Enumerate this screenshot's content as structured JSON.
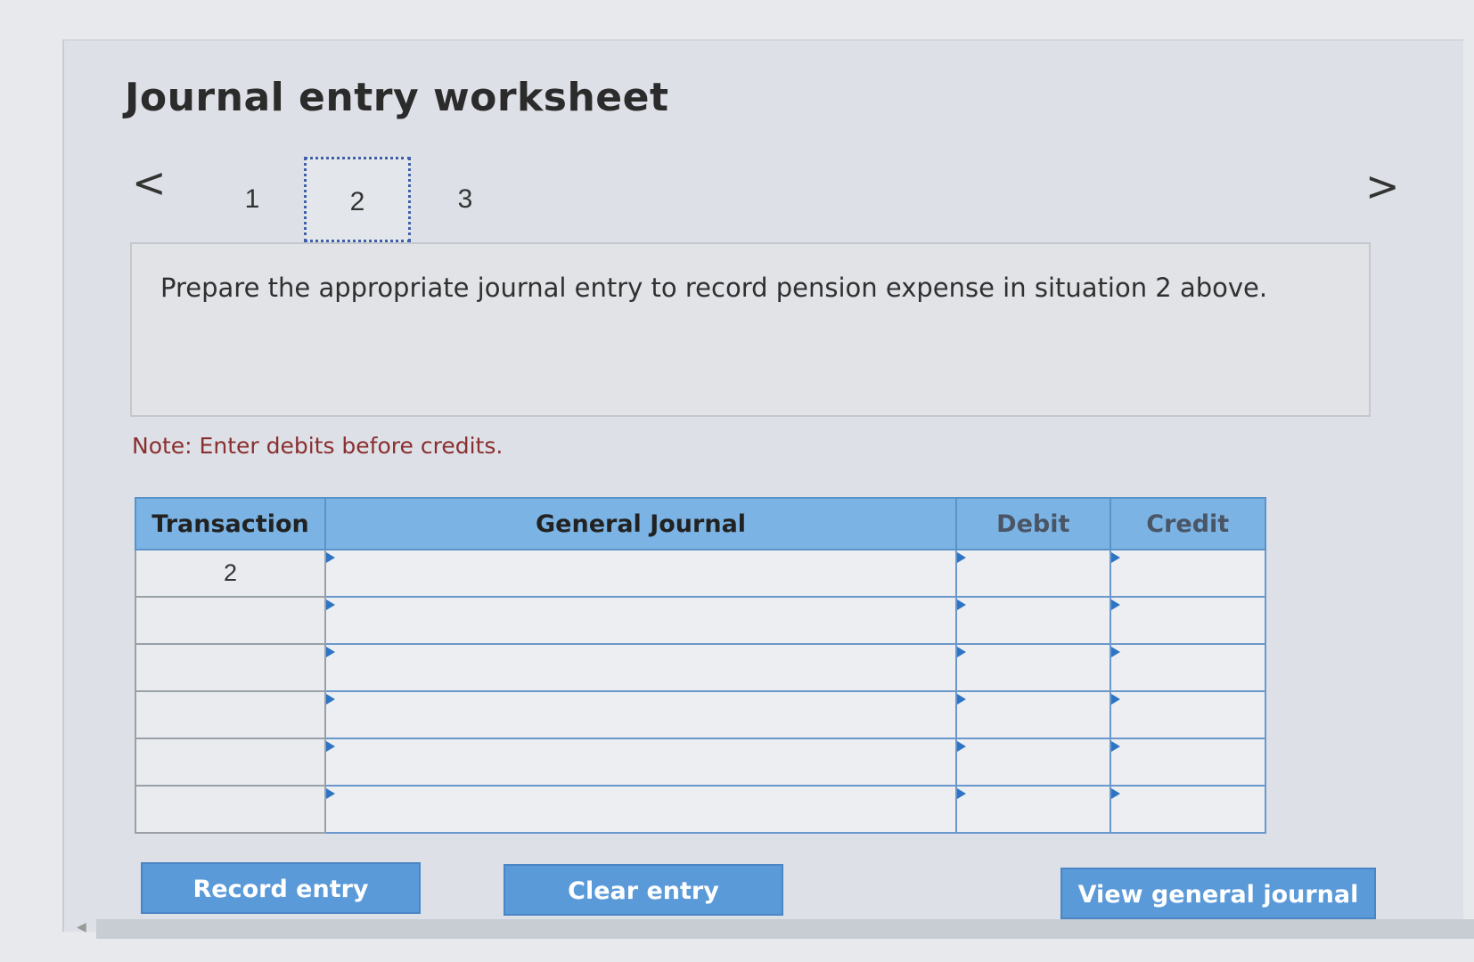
{
  "title": "Journal entry worksheet",
  "nav": {
    "prev": "<",
    "next": ">",
    "tabs": [
      "1",
      "2",
      "3"
    ],
    "active_tab": "2"
  },
  "question": "Prepare the appropriate journal entry to record pension expense in situation 2 above.",
  "note": "Note: Enter debits before credits.",
  "table": {
    "headers": {
      "transaction": "Transaction",
      "journal": "General Journal",
      "debit": "Debit",
      "credit": "Credit"
    },
    "rows": [
      {
        "transaction": "2",
        "journal": "",
        "debit": "",
        "credit": ""
      },
      {
        "transaction": "",
        "journal": "",
        "debit": "",
        "credit": ""
      },
      {
        "transaction": "",
        "journal": "",
        "debit": "",
        "credit": ""
      },
      {
        "transaction": "",
        "journal": "",
        "debit": "",
        "credit": ""
      },
      {
        "transaction": "",
        "journal": "",
        "debit": "",
        "credit": ""
      },
      {
        "transaction": "",
        "journal": "",
        "debit": "",
        "credit": ""
      }
    ]
  },
  "buttons": {
    "record": "Record entry",
    "clear": "Clear entry",
    "view": "View general journal"
  }
}
